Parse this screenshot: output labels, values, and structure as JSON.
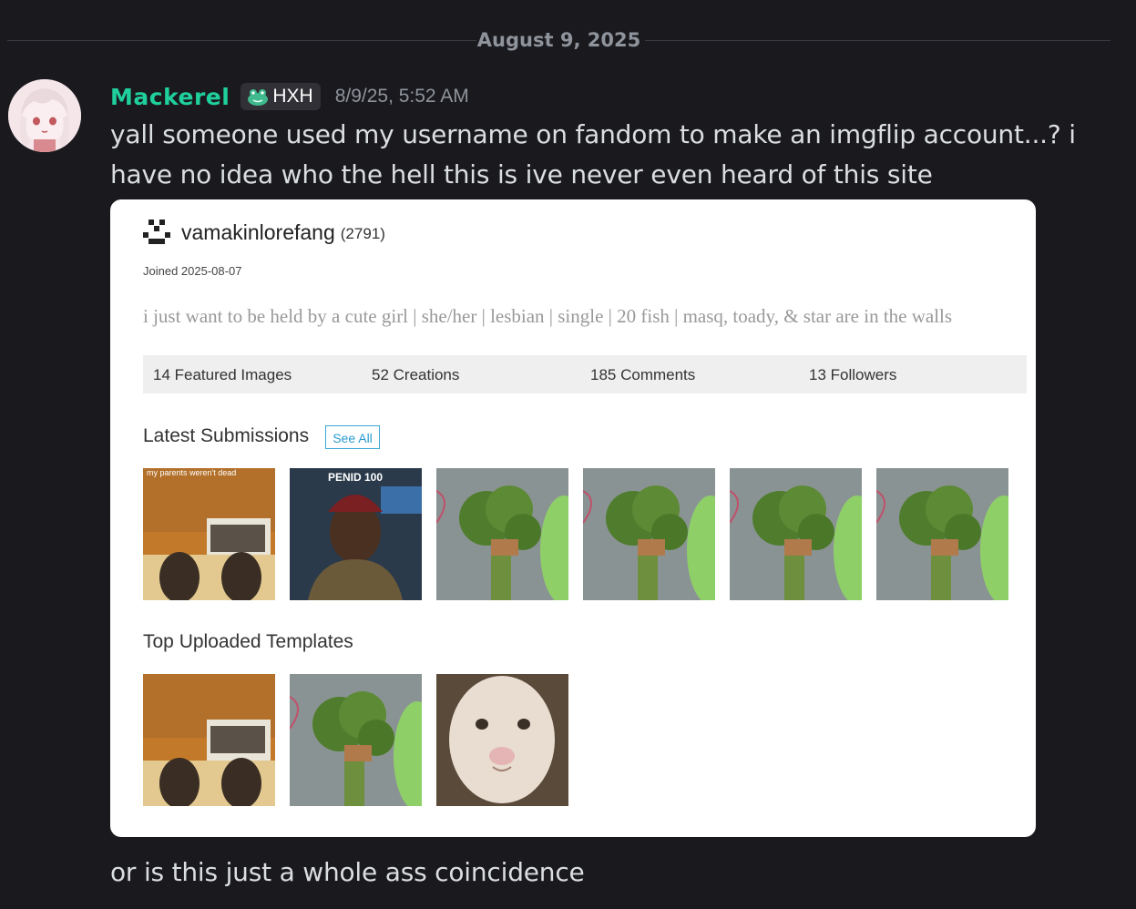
{
  "divider": {
    "date": "August 9, 2025"
  },
  "message": {
    "username": "Mackerel",
    "tag": "HXH",
    "timestamp": "8/9/25, 5:52 AM",
    "text1": "yall someone used my username on fandom to make an imgflip account...? i have no idea who the hell this is ive never even heard of this site",
    "text2": "or is this just a whole ass coincidence"
  },
  "embed": {
    "username": "vamakinlorefang",
    "points": "(2791)",
    "joined": "Joined 2025-08-07",
    "bio": "i just want to be held by a cute girl | she/her | lesbian | single | 20 fish | masq, toady, & star are in the walls",
    "stats": [
      "14 Featured Images",
      "52 Creations",
      "185 Comments",
      "13 Followers"
    ],
    "latest_heading": "Latest Submissions",
    "see_all": "See All",
    "latest_captions": [
      "my parents weren't dead",
      "PENID 100"
    ],
    "top_heading": "Top Uploaded Templates"
  },
  "icons": {
    "frog": "frog-icon",
    "pixel_avatar": "pixel-avatar-icon"
  },
  "colors": {
    "username": "#1fcf9c",
    "background": "#1a1a1e",
    "link": "#2a9bd0"
  }
}
